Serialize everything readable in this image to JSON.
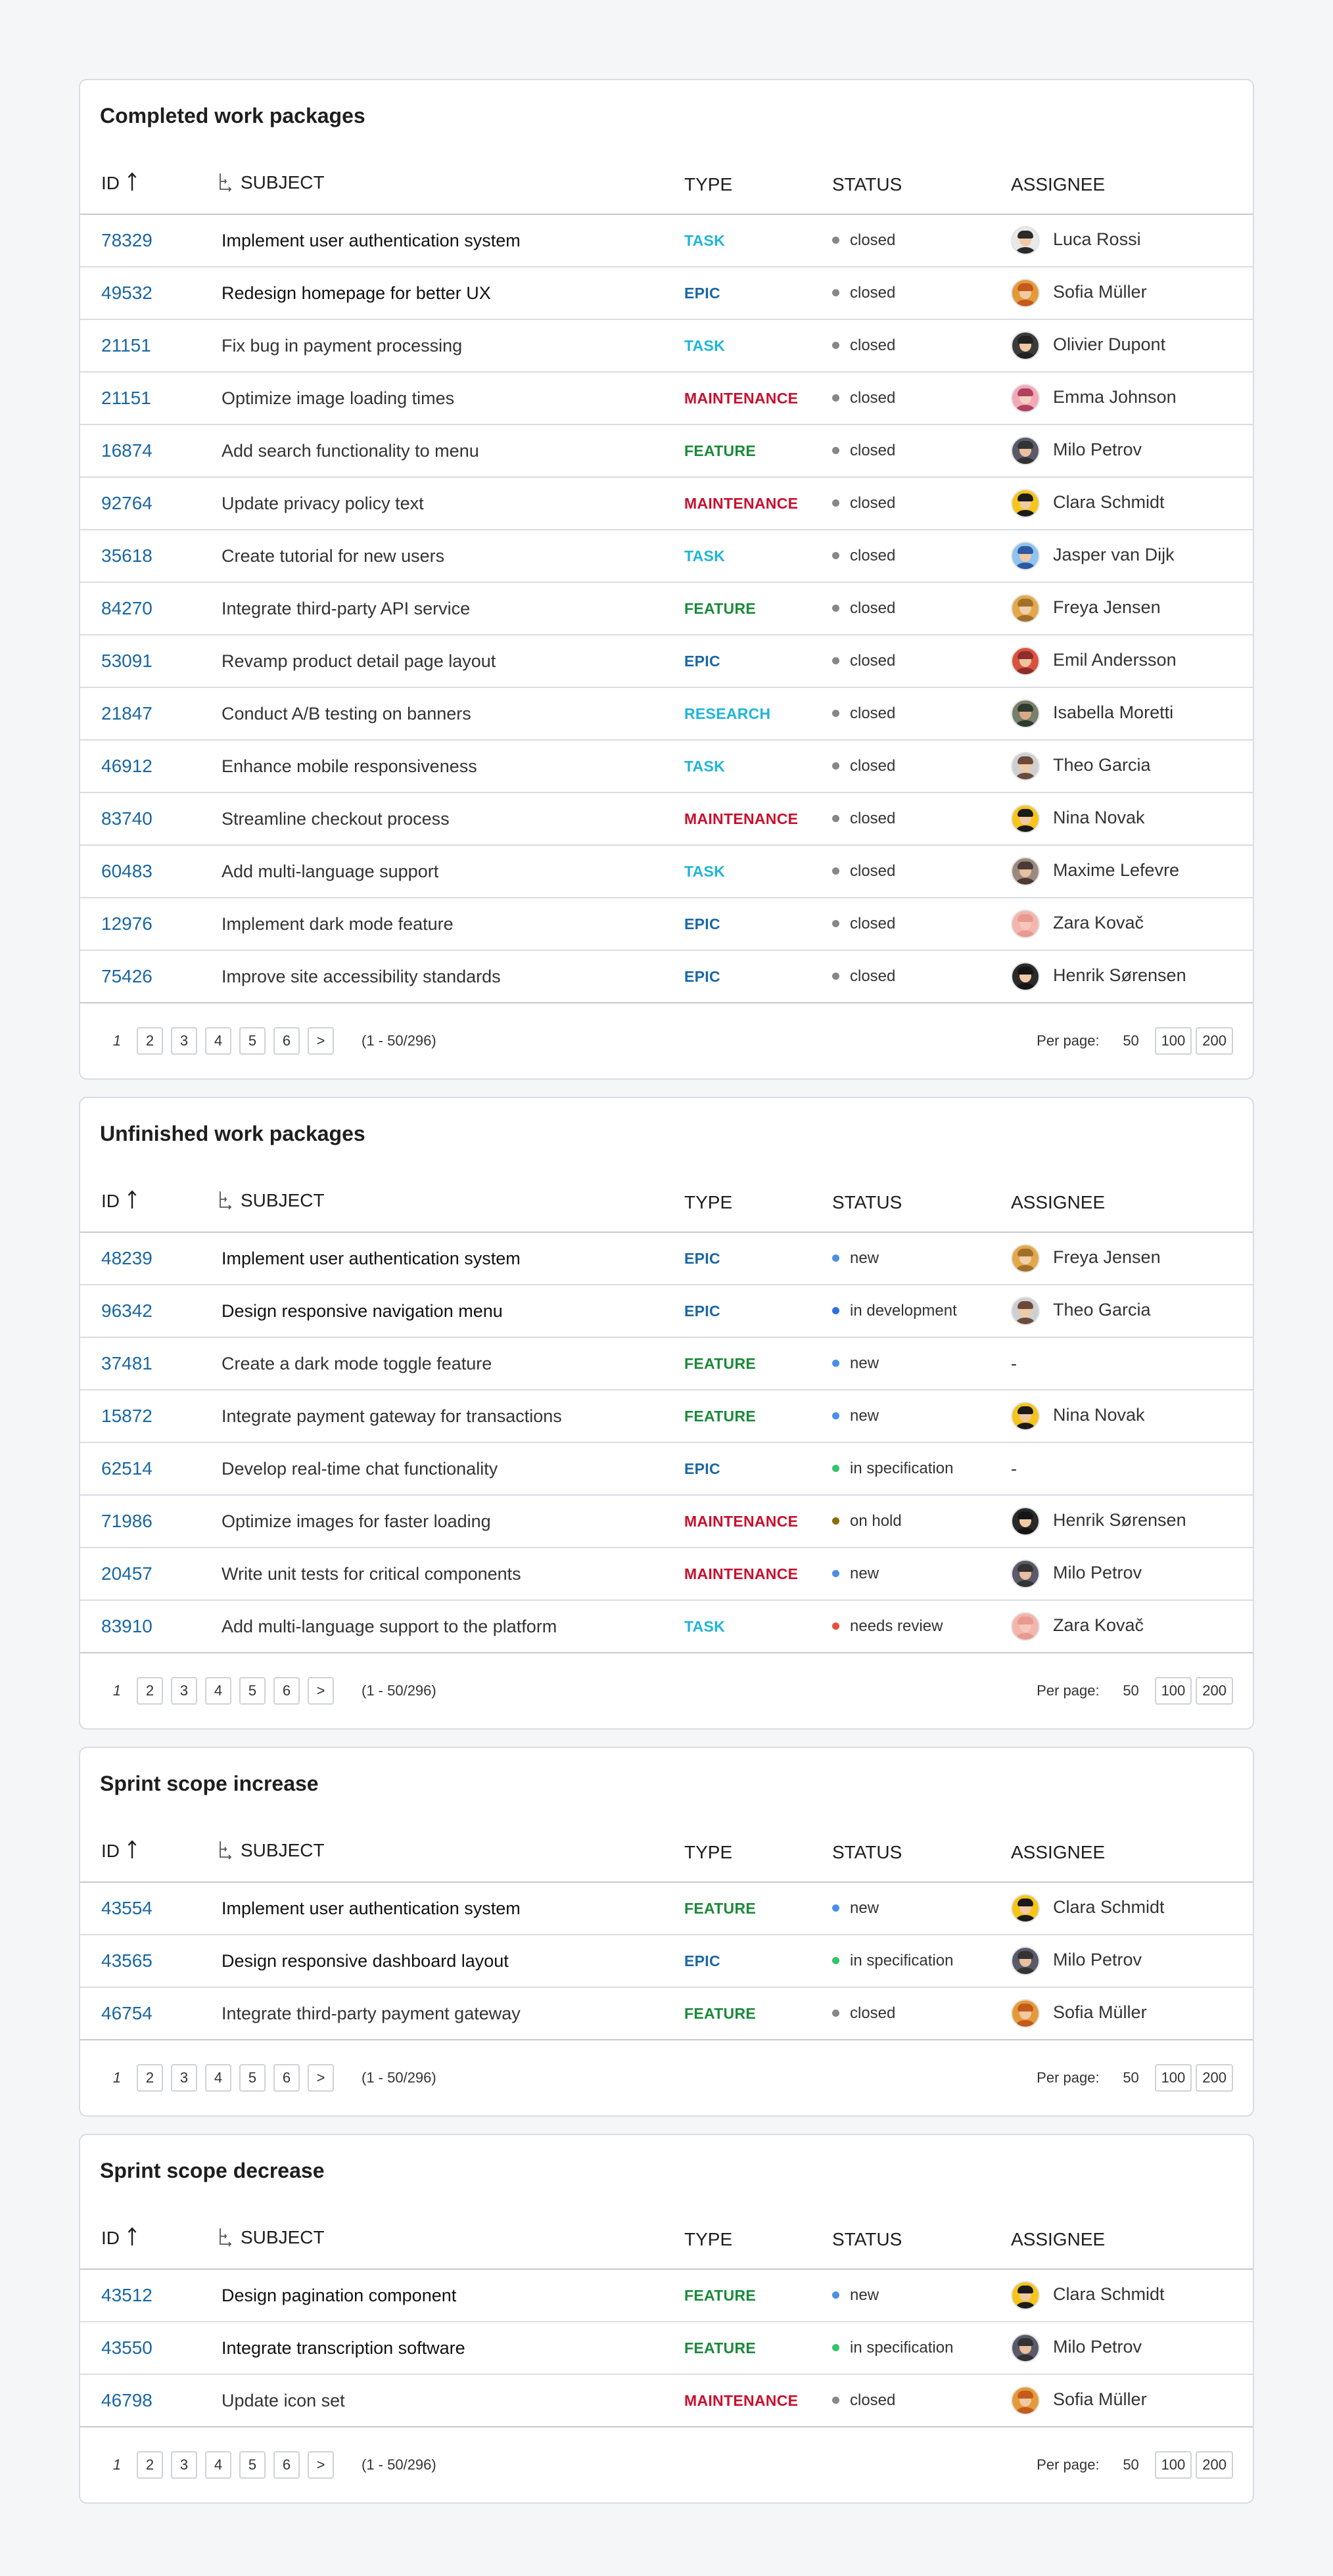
{
  "columns": {
    "id": "ID",
    "subject": "SUBJECT",
    "type": "TYPE",
    "status": "STATUS",
    "assignee": "ASSIGNEE"
  },
  "colors": {
    "types": {
      "TASK": "#1fb5d8",
      "EPIC": "#1a67a3",
      "MAINTENANCE": "#c8102e",
      "FEATURE": "#1a8a3a",
      "RESEARCH": "#1fb5d8"
    },
    "status": {
      "closed": "#878787",
      "new": "#4a90e2",
      "in development": "#2f6fe0",
      "in specification": "#35c26a",
      "on hold": "#8a6d0b",
      "needs review": "#e8503a"
    },
    "link": "#1a67a3"
  },
  "icons": {
    "sort": "arrow-up-icon",
    "tree": "hierarchy-icon"
  },
  "pagination": {
    "current": "1",
    "pages": [
      "2",
      "3",
      "4",
      "5",
      "6",
      ">"
    ],
    "range": "(1 - 50/296)",
    "per_page_label": "Per page:",
    "per_page_current": "50",
    "per_page_options": [
      "100",
      "200"
    ]
  },
  "panels": [
    {
      "title": "Completed work packages",
      "rows": [
        {
          "id": "78329",
          "subject": "Implement user authentication system",
          "type": "TASK",
          "status": "closed",
          "assignee": "Luca Rossi"
        },
        {
          "id": "49532",
          "subject": "Redesign homepage for better UX",
          "type": "EPIC",
          "status": "closed",
          "assignee": "Sofia Müller"
        },
        {
          "id": "21151",
          "subject": "Fix bug in payment processing",
          "type": "TASK",
          "status": "closed",
          "assignee": "Olivier Dupont"
        },
        {
          "id": "21151",
          "subject": "Optimize image loading times",
          "type": "MAINTENANCE",
          "status": "closed",
          "assignee": "Emma Johnson"
        },
        {
          "id": "16874",
          "subject": "Add search functionality to menu",
          "type": "FEATURE",
          "status": "closed",
          "assignee": "Milo Petrov"
        },
        {
          "id": "92764",
          "subject": "Update privacy policy text",
          "type": "MAINTENANCE",
          "status": "closed",
          "assignee": "Clara Schmidt"
        },
        {
          "id": "35618",
          "subject": "Create tutorial for new users",
          "type": "TASK",
          "status": "closed",
          "assignee": "Jasper van Dijk"
        },
        {
          "id": "84270",
          "subject": "Integrate third-party API service",
          "type": "FEATURE",
          "status": "closed",
          "assignee": "Freya Jensen"
        },
        {
          "id": "53091",
          "subject": "Revamp product detail page layout",
          "type": "EPIC",
          "status": "closed",
          "assignee": "Emil Andersson"
        },
        {
          "id": "21847",
          "subject": "Conduct A/B testing on banners",
          "type": "RESEARCH",
          "status": "closed",
          "assignee": "Isabella Moretti"
        },
        {
          "id": "46912",
          "subject": "Enhance mobile responsiveness",
          "type": "TASK",
          "status": "closed",
          "assignee": "Theo Garcia"
        },
        {
          "id": "83740",
          "subject": "Streamline checkout process",
          "type": "MAINTENANCE",
          "status": "closed",
          "assignee": "Nina Novak"
        },
        {
          "id": "60483",
          "subject": "Add multi-language support",
          "type": "TASK",
          "status": "closed",
          "assignee": "Maxime Lefevre"
        },
        {
          "id": "12976",
          "subject": "Implement dark mode feature",
          "type": "EPIC",
          "status": "closed",
          "assignee": "Zara Kovač"
        },
        {
          "id": "75426",
          "subject": "Improve site accessibility standards",
          "type": "EPIC",
          "status": "closed",
          "assignee": "Henrik Sørensen"
        }
      ]
    },
    {
      "title": "Unfinished work packages",
      "rows": [
        {
          "id": "48239",
          "subject": "Implement user authentication system",
          "type": "EPIC",
          "status": "new",
          "assignee": "Freya Jensen"
        },
        {
          "id": "96342",
          "subject": "Design responsive navigation menu",
          "type": "EPIC",
          "status": "in development",
          "assignee": "Theo Garcia"
        },
        {
          "id": "37481",
          "subject": "Create a dark mode toggle feature",
          "type": "FEATURE",
          "status": "new",
          "assignee": "-"
        },
        {
          "id": "15872",
          "subject": "Integrate payment gateway for transactions",
          "type": "FEATURE",
          "status": "new",
          "assignee": "Nina Novak"
        },
        {
          "id": "62514",
          "subject": "Develop real-time chat functionality",
          "type": "EPIC",
          "status": "in specification",
          "assignee": "-"
        },
        {
          "id": "71986",
          "subject": "Optimize images for faster loading",
          "type": "MAINTENANCE",
          "status": "on hold",
          "assignee": "Henrik Sørensen"
        },
        {
          "id": "20457",
          "subject": "Write unit tests for critical components",
          "type": "MAINTENANCE",
          "status": "new",
          "assignee": "Milo Petrov"
        },
        {
          "id": "83910",
          "subject": "Add multi-language support to the platform",
          "type": "TASK",
          "status": "needs review",
          "assignee": "Zara Kovač"
        }
      ]
    },
    {
      "title": "Sprint scope increase",
      "rows": [
        {
          "id": "43554",
          "subject": "Implement user authentication system",
          "type": "FEATURE",
          "status": "new",
          "assignee": "Clara Schmidt"
        },
        {
          "id": "43565",
          "subject": "Design responsive dashboard layout",
          "type": "EPIC",
          "status": "in specification",
          "assignee": "Milo Petrov"
        },
        {
          "id": "46754",
          "subject": "Integrate third-party payment gateway",
          "type": "FEATURE",
          "status": "closed",
          "assignee": "Sofia Müller"
        }
      ]
    },
    {
      "title": "Sprint scope decrease",
      "rows": [
        {
          "id": "43512",
          "subject": "Design pagination component",
          "type": "FEATURE",
          "status": "new",
          "assignee": "Clara Schmidt"
        },
        {
          "id": "43550",
          "subject": "Integrate transcription software",
          "type": "FEATURE",
          "status": "in specification",
          "assignee": "Milo Petrov"
        },
        {
          "id": "46798",
          "subject": "Update icon set",
          "type": "MAINTENANCE",
          "status": "closed",
          "assignee": "Sofia Müller"
        }
      ]
    }
  ]
}
